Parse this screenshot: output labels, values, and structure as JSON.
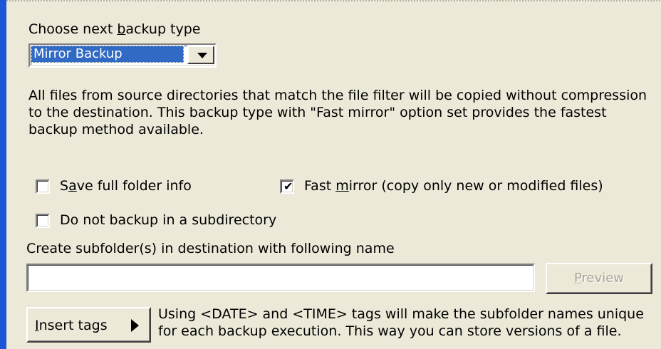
{
  "backup_type": {
    "label_pre": "Choose next ",
    "label_accel": "b",
    "label_post": "ackup type",
    "selected": "Mirror Backup"
  },
  "description": {
    "line1": "All files from source directories that match the file filter will be copied without compression",
    "line2": "to the destination. This backup type with \"Fast mirror\" option set provides the fastest",
    "line3": "backup method available."
  },
  "options": {
    "save_full_folder": {
      "pre": "S",
      "accel": "a",
      "post": "ve full folder info",
      "checked": false
    },
    "fast_mirror": {
      "pre": "Fast ",
      "accel": "m",
      "post": "irror (copy only new or modified files)",
      "checked": true
    },
    "no_subdirectory": {
      "label": "Do not backup in a subdirectory",
      "checked": false
    }
  },
  "subfolder": {
    "label": "Create subfolder(s) in destination with following name",
    "value": "",
    "preview_accel": "P",
    "preview_post": "review",
    "preview_enabled": false
  },
  "insert_tags": {
    "accel": "I",
    "post": "nsert tags",
    "hint_line1": "Using <DATE> and <TIME> tags will make the subfolder names unique",
    "hint_line2": "for each backup execution. This way you can store versions of a file."
  },
  "colors": {
    "selection": "#316ac5",
    "accent_bar": "#1c56d6",
    "panel": "#ece9d8"
  },
  "icons": {
    "dropdown": "chevron-down-icon",
    "submenu": "arrow-right-icon",
    "check": "checkmark-icon"
  }
}
